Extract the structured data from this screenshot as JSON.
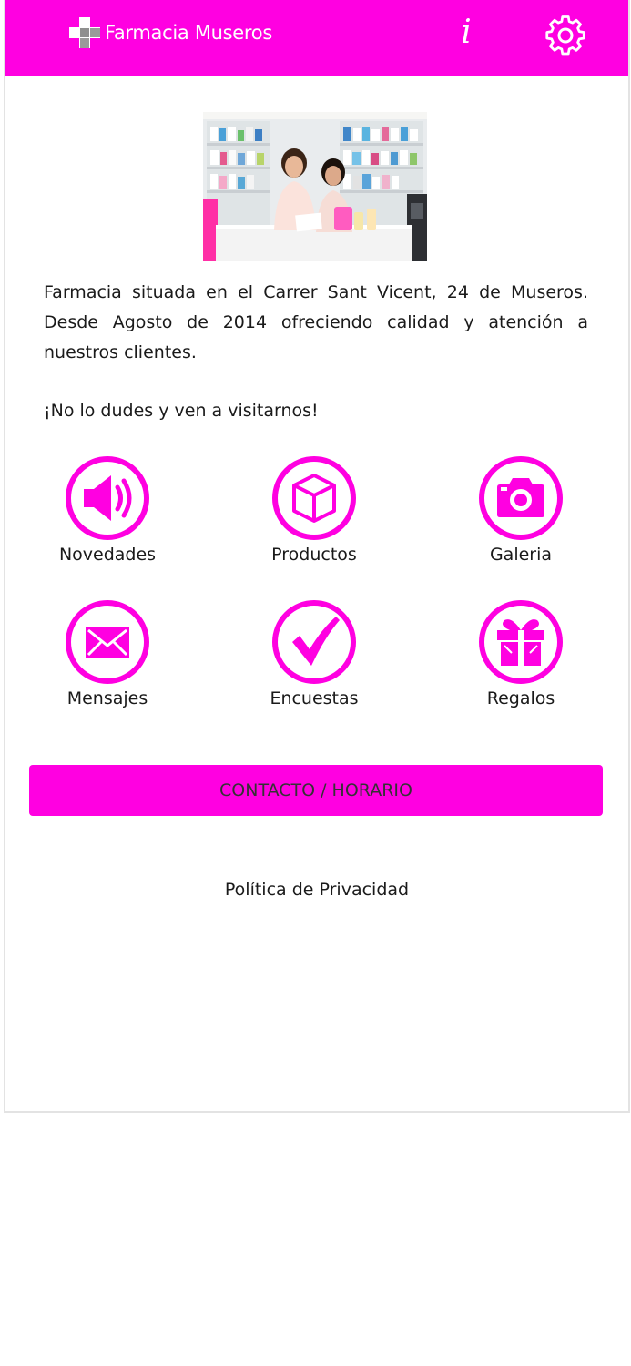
{
  "header": {
    "title": "Farmacia Museros",
    "info_label": "i",
    "brand_color": "#ff00e1",
    "logo_icon": "pharmacy-cross-icon",
    "settings_icon": "gear-icon"
  },
  "intro": {
    "description": "Farmacia situada en el Carrer Sant Vicent, 24 de Museros. Desde Agosto de 2014 ofreciendo calidad y atención a nuestros clientes.",
    "tagline": "¡No lo dudes y ven a visitarnos!"
  },
  "menu": {
    "items": [
      {
        "label": "Novedades",
        "icon": "megaphone-icon"
      },
      {
        "label": "Productos",
        "icon": "box-icon"
      },
      {
        "label": "Galeria",
        "icon": "camera-icon"
      },
      {
        "label": "Mensajes",
        "icon": "envelope-icon"
      },
      {
        "label": "Encuestas",
        "icon": "checkmark-icon"
      },
      {
        "label": "Regalos",
        "icon": "gift-icon"
      }
    ]
  },
  "contact": {
    "label": "CONTACTO / HORARIO"
  },
  "footer": {
    "privacy_label": "Política de Privacidad"
  }
}
